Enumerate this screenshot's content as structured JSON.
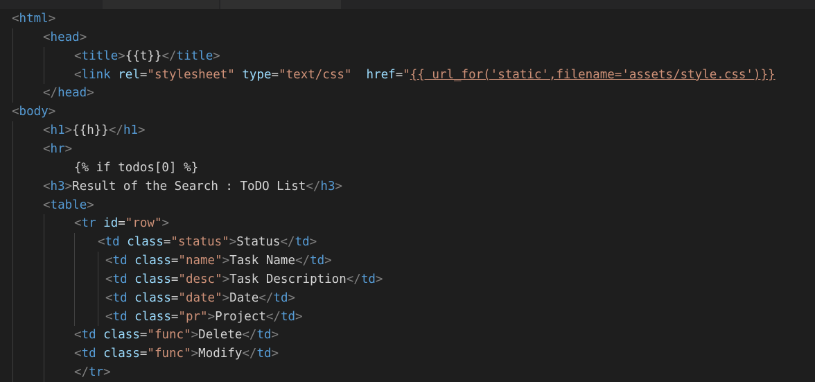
{
  "lines": [
    {
      "indent": 0,
      "tokens": [
        {
          "k": "br",
          "t": "<"
        },
        {
          "k": "tag",
          "t": "html"
        },
        {
          "k": "br",
          "t": ">"
        }
      ]
    },
    {
      "indent": 1,
      "tokens": [
        {
          "k": "br",
          "t": "<"
        },
        {
          "k": "tag",
          "t": "head"
        },
        {
          "k": "br",
          "t": ">"
        }
      ]
    },
    {
      "indent": 2,
      "tokens": [
        {
          "k": "br",
          "t": "<"
        },
        {
          "k": "tag",
          "t": "title"
        },
        {
          "k": "br",
          "t": ">"
        },
        {
          "k": "txt",
          "t": "{{t}}"
        },
        {
          "k": "br",
          "t": "</"
        },
        {
          "k": "tag",
          "t": "title"
        },
        {
          "k": "br",
          "t": ">"
        }
      ]
    },
    {
      "indent": 2,
      "tokens": [
        {
          "k": "br",
          "t": "<"
        },
        {
          "k": "tag",
          "t": "link"
        },
        {
          "k": "txt",
          "t": " "
        },
        {
          "k": "attr",
          "t": "rel"
        },
        {
          "k": "txt",
          "t": "="
        },
        {
          "k": "str",
          "t": "\"stylesheet\""
        },
        {
          "k": "txt",
          "t": " "
        },
        {
          "k": "attr",
          "t": "type"
        },
        {
          "k": "txt",
          "t": "="
        },
        {
          "k": "str",
          "t": "\"text/css\""
        },
        {
          "k": "txt",
          "t": "  "
        },
        {
          "k": "attr",
          "t": "href"
        },
        {
          "k": "txt",
          "t": "="
        },
        {
          "k": "str",
          "t": "\""
        },
        {
          "k": "str link",
          "t": "{{ url_for('static',filename='assets/style.css')}}"
        }
      ]
    },
    {
      "indent": 1,
      "tokens": [
        {
          "k": "br",
          "t": "</"
        },
        {
          "k": "tag",
          "t": "head"
        },
        {
          "k": "br",
          "t": ">"
        }
      ]
    },
    {
      "indent": 0,
      "tokens": [
        {
          "k": "br",
          "t": "<"
        },
        {
          "k": "tag",
          "t": "body"
        },
        {
          "k": "br",
          "t": ">"
        }
      ]
    },
    {
      "indent": 1,
      "tokens": [
        {
          "k": "br",
          "t": "<"
        },
        {
          "k": "tag",
          "t": "h1"
        },
        {
          "k": "br",
          "t": ">"
        },
        {
          "k": "txt",
          "t": "{{h}}"
        },
        {
          "k": "br",
          "t": "</"
        },
        {
          "k": "tag",
          "t": "h1"
        },
        {
          "k": "br",
          "t": ">"
        }
      ]
    },
    {
      "indent": 1,
      "tokens": [
        {
          "k": "br",
          "t": "<"
        },
        {
          "k": "tag",
          "t": "hr"
        },
        {
          "k": "br",
          "t": ">"
        }
      ]
    },
    {
      "indent": 2,
      "tokens": [
        {
          "k": "txt",
          "t": "{% if todos[0] %}"
        }
      ]
    },
    {
      "indent": 1,
      "tokens": [
        {
          "k": "br",
          "t": "<"
        },
        {
          "k": "tag",
          "t": "h3"
        },
        {
          "k": "br",
          "t": ">"
        },
        {
          "k": "txt",
          "t": "Result of the Search : ToDO List"
        },
        {
          "k": "br",
          "t": "</"
        },
        {
          "k": "tag",
          "t": "h3"
        },
        {
          "k": "br",
          "t": ">"
        }
      ]
    },
    {
      "indent": 1,
      "tokens": [
        {
          "k": "br",
          "t": "<"
        },
        {
          "k": "tag",
          "t": "table"
        },
        {
          "k": "br",
          "t": ">"
        }
      ]
    },
    {
      "indent": 2,
      "tokens": [
        {
          "k": "br",
          "t": "<"
        },
        {
          "k": "tag",
          "t": "tr"
        },
        {
          "k": "txt",
          "t": " "
        },
        {
          "k": "attr",
          "t": "id"
        },
        {
          "k": "txt",
          "t": "="
        },
        {
          "k": "str",
          "t": "\"row\""
        },
        {
          "k": "br",
          "t": ">"
        }
      ]
    },
    {
      "indent": 3,
      "tokens": [
        {
          "k": "br",
          "t": "<"
        },
        {
          "k": "tag",
          "t": "td"
        },
        {
          "k": "txt",
          "t": " "
        },
        {
          "k": "attr",
          "t": "class"
        },
        {
          "k": "txt",
          "t": "="
        },
        {
          "k": "str",
          "t": "\"status\""
        },
        {
          "k": "br",
          "t": ">"
        },
        {
          "k": "txt",
          "t": "Status"
        },
        {
          "k": "br",
          "t": "</"
        },
        {
          "k": "tag",
          "t": "td"
        },
        {
          "k": "br",
          "t": ">"
        }
      ]
    },
    {
      "indent": 4,
      "tokens": [
        {
          "k": "br",
          "t": "<"
        },
        {
          "k": "tag",
          "t": "td"
        },
        {
          "k": "txt",
          "t": " "
        },
        {
          "k": "attr",
          "t": "class"
        },
        {
          "k": "txt",
          "t": "="
        },
        {
          "k": "str",
          "t": "\"name\""
        },
        {
          "k": "br",
          "t": ">"
        },
        {
          "k": "txt",
          "t": "Task Name"
        },
        {
          "k": "br",
          "t": "</"
        },
        {
          "k": "tag",
          "t": "td"
        },
        {
          "k": "br",
          "t": ">"
        }
      ]
    },
    {
      "indent": 4,
      "tokens": [
        {
          "k": "br",
          "t": "<"
        },
        {
          "k": "tag",
          "t": "td"
        },
        {
          "k": "txt",
          "t": " "
        },
        {
          "k": "attr",
          "t": "class"
        },
        {
          "k": "txt",
          "t": "="
        },
        {
          "k": "str",
          "t": "\"desc\""
        },
        {
          "k": "br",
          "t": ">"
        },
        {
          "k": "txt",
          "t": "Task Description"
        },
        {
          "k": "br",
          "t": "</"
        },
        {
          "k": "tag",
          "t": "td"
        },
        {
          "k": "br",
          "t": ">"
        }
      ]
    },
    {
      "indent": 4,
      "tokens": [
        {
          "k": "br",
          "t": "<"
        },
        {
          "k": "tag",
          "t": "td"
        },
        {
          "k": "txt",
          "t": " "
        },
        {
          "k": "attr",
          "t": "class"
        },
        {
          "k": "txt",
          "t": "="
        },
        {
          "k": "str",
          "t": "\"date\""
        },
        {
          "k": "br",
          "t": ">"
        },
        {
          "k": "txt",
          "t": "Date"
        },
        {
          "k": "br",
          "t": "</"
        },
        {
          "k": "tag",
          "t": "td"
        },
        {
          "k": "br",
          "t": ">"
        }
      ]
    },
    {
      "indent": 4,
      "tokens": [
        {
          "k": "br",
          "t": "<"
        },
        {
          "k": "tag",
          "t": "td"
        },
        {
          "k": "txt",
          "t": " "
        },
        {
          "k": "attr",
          "t": "class"
        },
        {
          "k": "txt",
          "t": "="
        },
        {
          "k": "str",
          "t": "\"pr\""
        },
        {
          "k": "br",
          "t": ">"
        },
        {
          "k": "txt",
          "t": "Project"
        },
        {
          "k": "br",
          "t": "</"
        },
        {
          "k": "tag",
          "t": "td"
        },
        {
          "k": "br",
          "t": ">"
        }
      ]
    },
    {
      "indent": 2,
      "tokens": [
        {
          "k": "br",
          "t": "<"
        },
        {
          "k": "tag",
          "t": "td"
        },
        {
          "k": "txt",
          "t": " "
        },
        {
          "k": "attr",
          "t": "class"
        },
        {
          "k": "txt",
          "t": "="
        },
        {
          "k": "str",
          "t": "\"func\""
        },
        {
          "k": "br",
          "t": ">"
        },
        {
          "k": "txt",
          "t": "Delete"
        },
        {
          "k": "br",
          "t": "</"
        },
        {
          "k": "tag",
          "t": "td"
        },
        {
          "k": "br",
          "t": ">"
        }
      ]
    },
    {
      "indent": 2,
      "tokens": [
        {
          "k": "br",
          "t": "<"
        },
        {
          "k": "tag",
          "t": "td"
        },
        {
          "k": "txt",
          "t": " "
        },
        {
          "k": "attr",
          "t": "class"
        },
        {
          "k": "txt",
          "t": "="
        },
        {
          "k": "str",
          "t": "\"func\""
        },
        {
          "k": "br",
          "t": ">"
        },
        {
          "k": "txt",
          "t": "Modify"
        },
        {
          "k": "br",
          "t": "</"
        },
        {
          "k": "tag",
          "t": "td"
        },
        {
          "k": "br",
          "t": ">"
        }
      ]
    },
    {
      "indent": 2,
      "tokens": [
        {
          "k": "br",
          "t": "</"
        },
        {
          "k": "tag",
          "t": "tr"
        },
        {
          "k": "br",
          "t": ">"
        }
      ]
    }
  ]
}
